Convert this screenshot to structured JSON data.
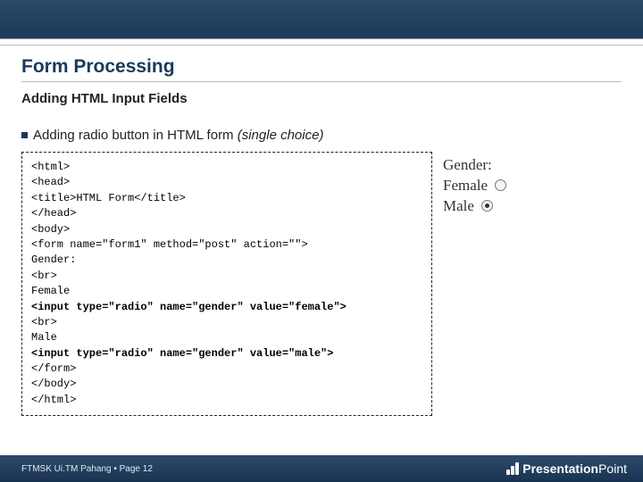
{
  "header": {
    "title": "Form Processing",
    "subtitle": "Adding HTML Input Fields"
  },
  "bullet": {
    "text_plain": "Adding radio button in HTML form ",
    "text_italic": "(single choice)"
  },
  "code": {
    "l1": "<html>",
    "l2": "<head>",
    "l3": "<title>HTML Form</title>",
    "l4": "</head>",
    "l5": "<body>",
    "l6": "<form name=\"form1\" method=\"post\" action=\"\">",
    "l7": "Gender:",
    "l8": "<br>",
    "l9": "Female",
    "l10": "<input type=\"radio\" name=\"gender\" value=\"female\">",
    "l11": "<br>",
    "l12": "Male",
    "l13": "<input type=\"radio\" name=\"gender\" value=\"male\">",
    "l14": "</form>",
    "l15": "</body>",
    "l16": "</html>"
  },
  "preview": {
    "label": "Gender:",
    "option1": "Female",
    "option2": "Male"
  },
  "footer": {
    "left": "FTMSK Ui.TM Pahang  •  Page 12",
    "logo_bold": "Presentation",
    "logo_light": "Point"
  }
}
